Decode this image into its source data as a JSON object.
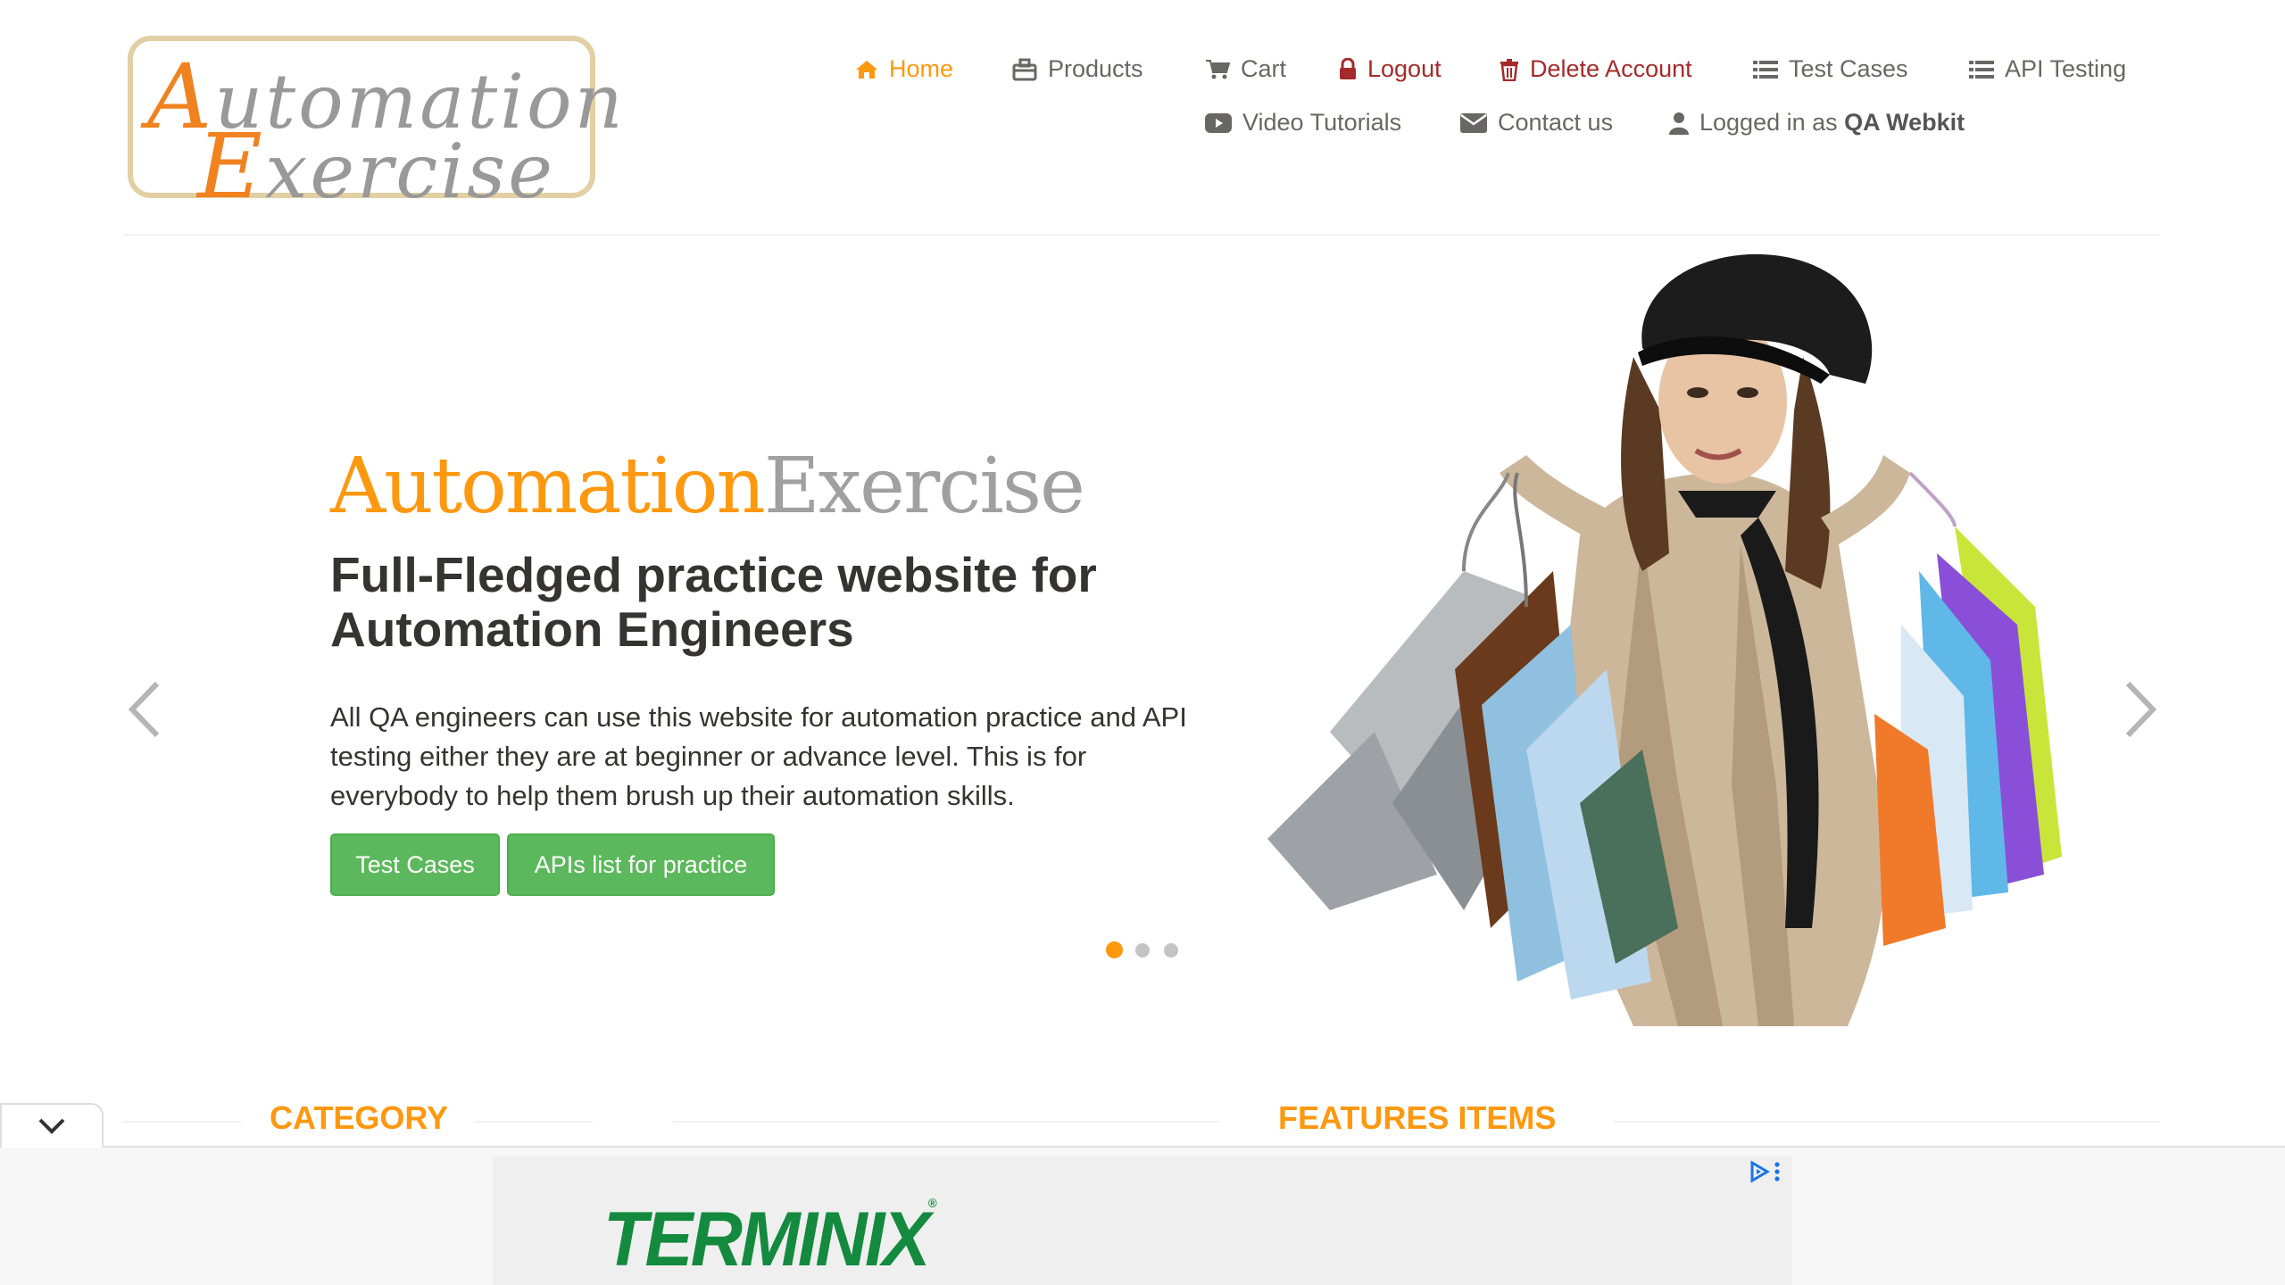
{
  "logo": {
    "line1_cap": "A",
    "line1_rest": "utomation",
    "line2_cap": "E",
    "line2_rest": "xercise"
  },
  "nav": {
    "home": "Home",
    "products": "Products",
    "cart": "Cart",
    "logout": "Logout",
    "delete_account": "Delete Account",
    "test_cases": "Test Cases",
    "api_testing": "API Testing",
    "video_tutorials": "Video Tutorials",
    "contact_us": "Contact us",
    "logged_in_prefix": "Logged in as",
    "logged_in_user": "QA Webkit"
  },
  "hero": {
    "brand_part1": "Automation",
    "brand_part2": "Exercise",
    "heading": "Full-Fledged practice website for Automation Engineers",
    "paragraph": "All QA engineers can use this website for automation practice and API testing either they are at beginner or advance level. This is for everybody to help them brush up their automation skills.",
    "btn_test_cases": "Test Cases",
    "btn_apis": "APIs list for practice",
    "slide_count": 3,
    "active_slide": 1
  },
  "sections": {
    "category": "CATEGORY",
    "features": "FEATURES ITEMS"
  },
  "ad": {
    "brand": "TERMINIX",
    "reg": "®"
  },
  "colors": {
    "accent": "#fe980f",
    "danger": "#a52a2a",
    "green": "#5cb85c",
    "ad_green": "#138a3e"
  }
}
